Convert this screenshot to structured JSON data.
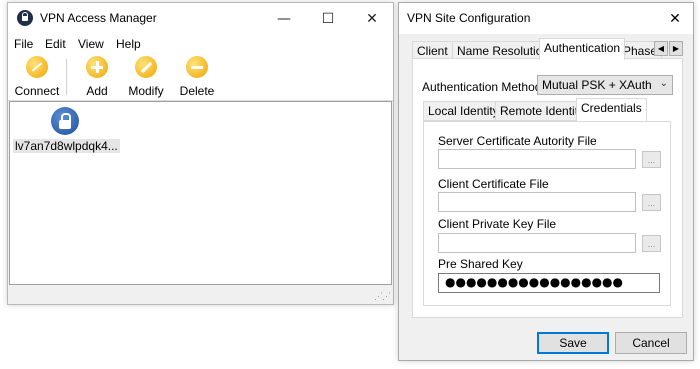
{
  "main_window": {
    "title": "VPN Access Manager",
    "caption": {
      "minimize": "—",
      "maximize": "☐",
      "close": "✕"
    },
    "menu": [
      "File",
      "Edit",
      "View",
      "Help"
    ],
    "toolbar": {
      "connect": "Connect",
      "add": "Add",
      "modify": "Modify",
      "delete": "Delete"
    },
    "connections": [
      {
        "label": "lv7an7d8wlpdqk4...",
        "icon": "vpn-lock-icon"
      }
    ]
  },
  "dialog": {
    "title": "VPN Site Configuration",
    "close": "✕",
    "tabs": [
      "Client",
      "Name Resolution",
      "Authentication",
      "Phase"
    ],
    "active_tab": "Authentication",
    "tab_scroll": {
      "left": "◀",
      "right": "▶"
    },
    "auth_method_label": "Authentication Method",
    "auth_method_value": "Mutual PSK + XAuth",
    "subtabs": [
      "Local Identity",
      "Remote Identity",
      "Credentials"
    ],
    "active_subtab": "Credentials",
    "fields": {
      "server_cert_label": "Server Certificate Autority File",
      "client_cert_label": "Client Certificate File",
      "client_key_label": "Client Private Key File",
      "psk_label": "Pre Shared Key",
      "psk_value": "●●●●●●●●●●●●●●●●●",
      "browse_label": "..."
    },
    "buttons": {
      "save": "Save",
      "cancel": "Cancel"
    }
  },
  "colors": {
    "accent": "#0078d7",
    "toolbar_icon": "#f0a500",
    "connection_icon": "#1f4f9a"
  }
}
